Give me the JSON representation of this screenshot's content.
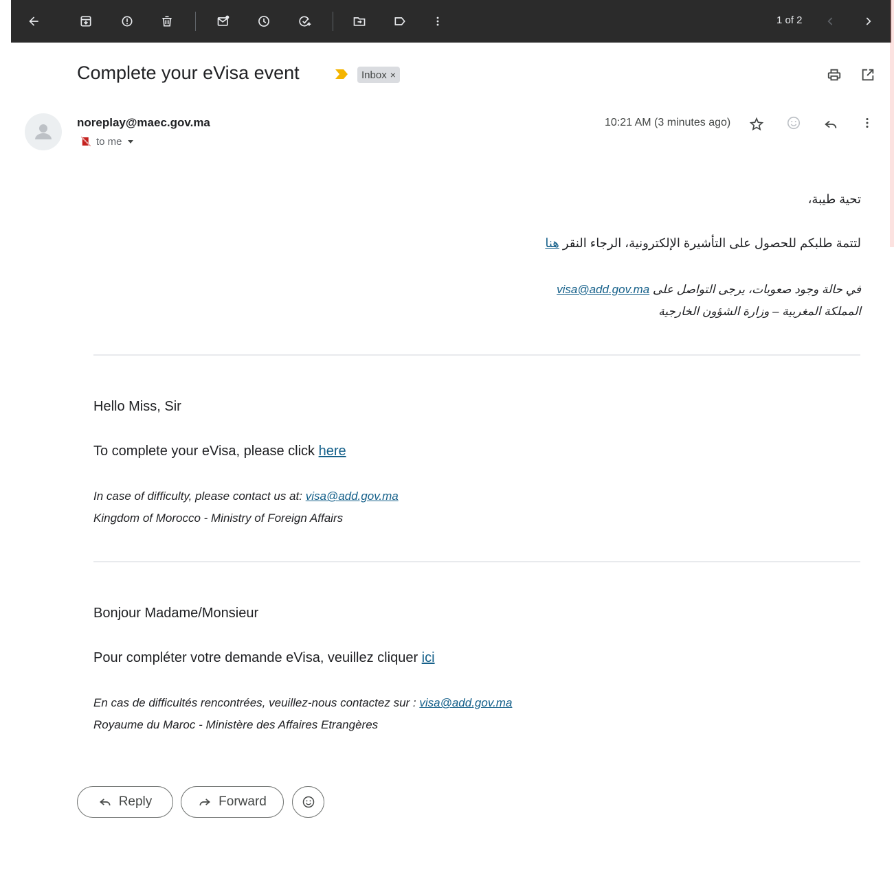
{
  "toolbar": {
    "icons": [
      "back-arrow-icon",
      "archive-icon",
      "report-spam-icon",
      "delete-icon",
      "mark-unread-icon",
      "snooze-icon",
      "add-to-tasks-icon",
      "move-to-icon",
      "label-icon",
      "more-vert-icon"
    ],
    "pager_text": "1 of 2"
  },
  "message": {
    "subject": "Complete your eVisa event",
    "label": "Inbox",
    "label_remove": "×",
    "sender": "noreplay@maec.gov.ma",
    "to": "to me",
    "time": "10:21 AM (3 minutes ago)"
  },
  "body": {
    "ar": {
      "greeting": "تحية طيبة،",
      "line1": "لتتمة طلبكم للحصول على التأشيرة الإلكترونية، الرجاء النقر",
      "line1_link": "هنا",
      "contact": "في حالة وجود صعوبات، يرجى التواصل على",
      "contact_email": "visa@add.gov.ma",
      "signature": "المملكة المغربية – وزارة الشؤون الخارجية"
    },
    "en": {
      "greeting": "Hello Miss, Sir",
      "line1": "To complete your eVisa, please click",
      "line1_link": "here",
      "contact": "In case of difficulty, please contact us at:",
      "contact_email": "visa@add.gov.ma",
      "signature": "Kingdom of Morocco - Ministry of Foreign Affairs"
    },
    "fr": {
      "greeting": "Bonjour Madame/Monsieur",
      "line1": "Pour compléter votre demande eVisa, veuillez cliquer",
      "line1_link": "ici",
      "contact": "En cas de difficultés rencontrées, veuillez-nous contactez sur :",
      "contact_email": "visa@add.gov.ma",
      "signature": "Royaume du Maroc - Ministère des Affaires Etrangères"
    }
  },
  "actions": {
    "reply": "Reply",
    "forward": "Forward"
  },
  "colors": {
    "toolbar_bg": "#2b2b2b",
    "link": "#15608a",
    "importance_marker": "#f4b400"
  }
}
